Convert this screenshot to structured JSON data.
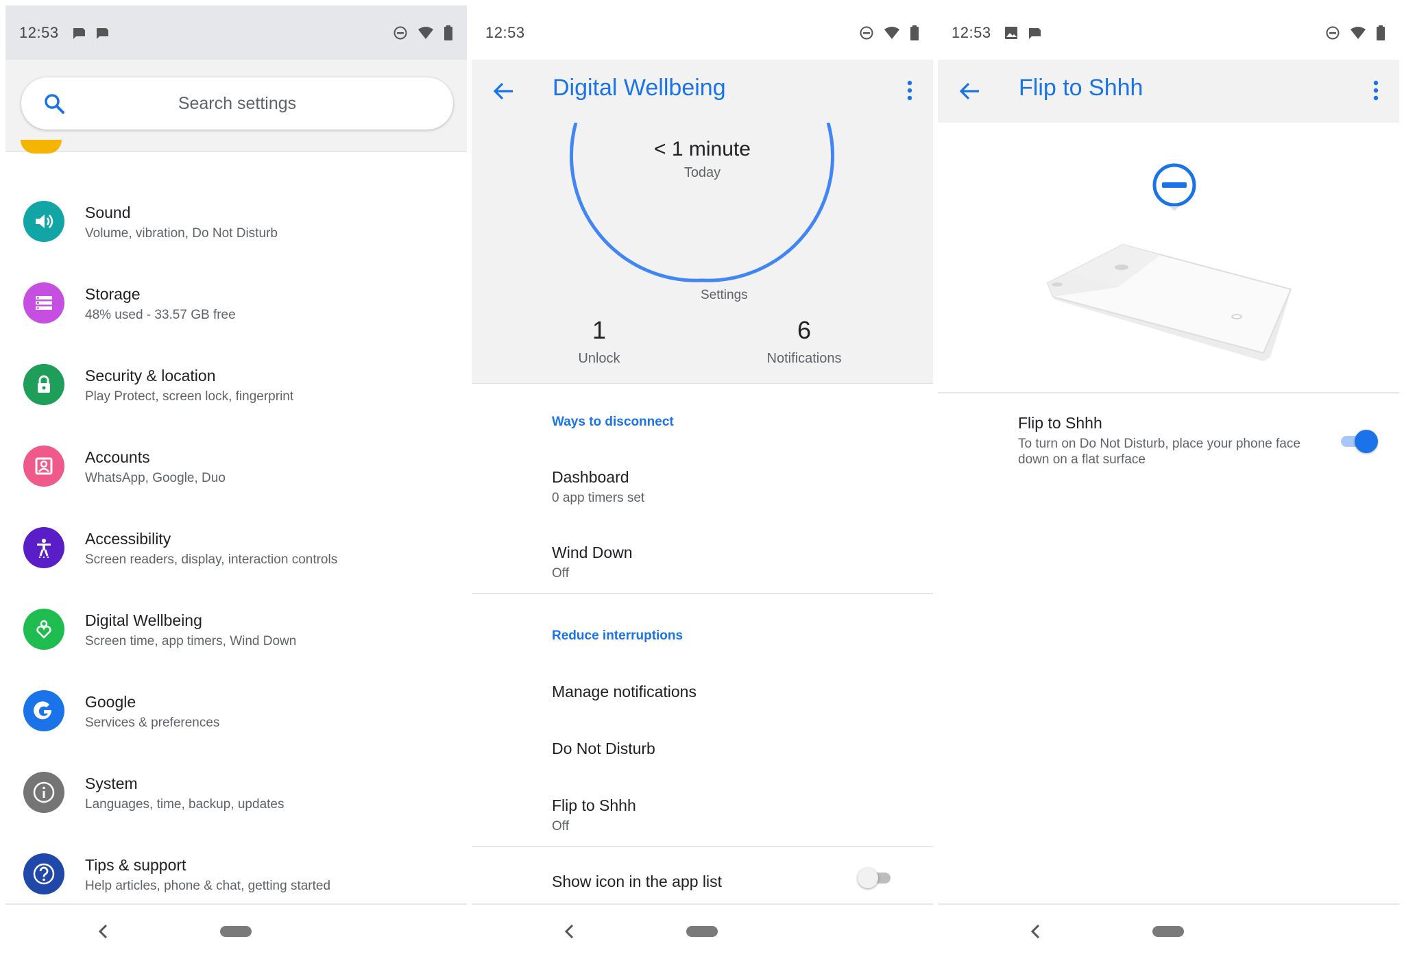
{
  "screens": [
    {
      "status_time": "12:53",
      "search_placeholder": "Search settings",
      "settings": [
        {
          "title": "Sound",
          "subtitle": "Volume, vibration, Do Not Disturb",
          "icon": "volume-icon",
          "color": "#12a5a5"
        },
        {
          "title": "Storage",
          "subtitle": "48% used - 33.57 GB free",
          "icon": "storage-icon",
          "color": "#c64ee0"
        },
        {
          "title": "Security & location",
          "subtitle": "Play Protect, screen lock, fingerprint",
          "icon": "lock-icon",
          "color": "#1e9e58"
        },
        {
          "title": "Accounts",
          "subtitle": "WhatsApp, Google, Duo",
          "icon": "account-icon",
          "color": "#ef5a8a"
        },
        {
          "title": "Accessibility",
          "subtitle": "Screen readers, display, interaction controls",
          "icon": "accessibility-icon",
          "color": "#5a1ec9"
        },
        {
          "title": "Digital Wellbeing",
          "subtitle": "Screen time, app timers, Wind Down",
          "icon": "wellbeing-heart-icon",
          "color": "#1fbd4f"
        },
        {
          "title": "Google",
          "subtitle": "Services & preferences",
          "icon": "google-icon",
          "color": "#1a73e8"
        },
        {
          "title": "System",
          "subtitle": "Languages, time, backup, updates",
          "icon": "info-icon",
          "color": "#757575"
        },
        {
          "title": "Tips & support",
          "subtitle": "Help articles, phone & chat, getting started",
          "icon": "help-icon",
          "color": "#1f48a8"
        }
      ]
    },
    {
      "status_time": "12:53",
      "title": "Digital Wellbeing",
      "ring_time": "< 1 minute",
      "ring_today": "Today",
      "ring_label": "Settings",
      "unlocks_value": "1",
      "unlocks_label": "Unlock",
      "notifications_value": "6",
      "notifications_label": "Notifications",
      "ways_header": "Ways to disconnect",
      "dashboard_title": "Dashboard",
      "dashboard_sub": "0 app timers set",
      "wind_title": "Wind Down",
      "wind_sub": "Off",
      "reduce_header": "Reduce interruptions",
      "manage_title": "Manage notifications",
      "dnd_title": "Do Not Disturb",
      "flip_title": "Flip to Shhh",
      "flip_sub": "Off",
      "show_icon_title": "Show icon in the app list",
      "show_icon_enabled": false
    },
    {
      "status_time": "12:53",
      "title": "Flip to Shhh",
      "setting_title": "Flip to Shhh",
      "setting_desc": "To turn on Do Not Disturb, place your phone face down on a flat surface",
      "enabled": true
    }
  ],
  "accent_color": "#1a73e8"
}
